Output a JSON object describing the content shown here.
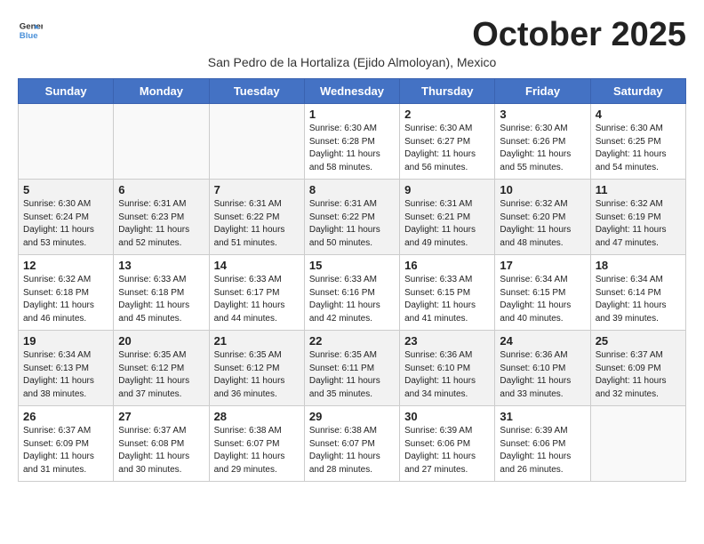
{
  "header": {
    "logo_line1": "General",
    "logo_line2": "Blue",
    "month_title": "October 2025",
    "subtitle": "San Pedro de la Hortaliza (Ejido Almoloyan), Mexico"
  },
  "days_of_week": [
    "Sunday",
    "Monday",
    "Tuesday",
    "Wednesday",
    "Thursday",
    "Friday",
    "Saturday"
  ],
  "weeks": [
    [
      {
        "day": "",
        "info": ""
      },
      {
        "day": "",
        "info": ""
      },
      {
        "day": "",
        "info": ""
      },
      {
        "day": "1",
        "info": "Sunrise: 6:30 AM\nSunset: 6:28 PM\nDaylight: 11 hours\nand 58 minutes."
      },
      {
        "day": "2",
        "info": "Sunrise: 6:30 AM\nSunset: 6:27 PM\nDaylight: 11 hours\nand 56 minutes."
      },
      {
        "day": "3",
        "info": "Sunrise: 6:30 AM\nSunset: 6:26 PM\nDaylight: 11 hours\nand 55 minutes."
      },
      {
        "day": "4",
        "info": "Sunrise: 6:30 AM\nSunset: 6:25 PM\nDaylight: 11 hours\nand 54 minutes."
      }
    ],
    [
      {
        "day": "5",
        "info": "Sunrise: 6:30 AM\nSunset: 6:24 PM\nDaylight: 11 hours\nand 53 minutes."
      },
      {
        "day": "6",
        "info": "Sunrise: 6:31 AM\nSunset: 6:23 PM\nDaylight: 11 hours\nand 52 minutes."
      },
      {
        "day": "7",
        "info": "Sunrise: 6:31 AM\nSunset: 6:22 PM\nDaylight: 11 hours\nand 51 minutes."
      },
      {
        "day": "8",
        "info": "Sunrise: 6:31 AM\nSunset: 6:22 PM\nDaylight: 11 hours\nand 50 minutes."
      },
      {
        "day": "9",
        "info": "Sunrise: 6:31 AM\nSunset: 6:21 PM\nDaylight: 11 hours\nand 49 minutes."
      },
      {
        "day": "10",
        "info": "Sunrise: 6:32 AM\nSunset: 6:20 PM\nDaylight: 11 hours\nand 48 minutes."
      },
      {
        "day": "11",
        "info": "Sunrise: 6:32 AM\nSunset: 6:19 PM\nDaylight: 11 hours\nand 47 minutes."
      }
    ],
    [
      {
        "day": "12",
        "info": "Sunrise: 6:32 AM\nSunset: 6:18 PM\nDaylight: 11 hours\nand 46 minutes."
      },
      {
        "day": "13",
        "info": "Sunrise: 6:33 AM\nSunset: 6:18 PM\nDaylight: 11 hours\nand 45 minutes."
      },
      {
        "day": "14",
        "info": "Sunrise: 6:33 AM\nSunset: 6:17 PM\nDaylight: 11 hours\nand 44 minutes."
      },
      {
        "day": "15",
        "info": "Sunrise: 6:33 AM\nSunset: 6:16 PM\nDaylight: 11 hours\nand 42 minutes."
      },
      {
        "day": "16",
        "info": "Sunrise: 6:33 AM\nSunset: 6:15 PM\nDaylight: 11 hours\nand 41 minutes."
      },
      {
        "day": "17",
        "info": "Sunrise: 6:34 AM\nSunset: 6:15 PM\nDaylight: 11 hours\nand 40 minutes."
      },
      {
        "day": "18",
        "info": "Sunrise: 6:34 AM\nSunset: 6:14 PM\nDaylight: 11 hours\nand 39 minutes."
      }
    ],
    [
      {
        "day": "19",
        "info": "Sunrise: 6:34 AM\nSunset: 6:13 PM\nDaylight: 11 hours\nand 38 minutes."
      },
      {
        "day": "20",
        "info": "Sunrise: 6:35 AM\nSunset: 6:12 PM\nDaylight: 11 hours\nand 37 minutes."
      },
      {
        "day": "21",
        "info": "Sunrise: 6:35 AM\nSunset: 6:12 PM\nDaylight: 11 hours\nand 36 minutes."
      },
      {
        "day": "22",
        "info": "Sunrise: 6:35 AM\nSunset: 6:11 PM\nDaylight: 11 hours\nand 35 minutes."
      },
      {
        "day": "23",
        "info": "Sunrise: 6:36 AM\nSunset: 6:10 PM\nDaylight: 11 hours\nand 34 minutes."
      },
      {
        "day": "24",
        "info": "Sunrise: 6:36 AM\nSunset: 6:10 PM\nDaylight: 11 hours\nand 33 minutes."
      },
      {
        "day": "25",
        "info": "Sunrise: 6:37 AM\nSunset: 6:09 PM\nDaylight: 11 hours\nand 32 minutes."
      }
    ],
    [
      {
        "day": "26",
        "info": "Sunrise: 6:37 AM\nSunset: 6:09 PM\nDaylight: 11 hours\nand 31 minutes."
      },
      {
        "day": "27",
        "info": "Sunrise: 6:37 AM\nSunset: 6:08 PM\nDaylight: 11 hours\nand 30 minutes."
      },
      {
        "day": "28",
        "info": "Sunrise: 6:38 AM\nSunset: 6:07 PM\nDaylight: 11 hours\nand 29 minutes."
      },
      {
        "day": "29",
        "info": "Sunrise: 6:38 AM\nSunset: 6:07 PM\nDaylight: 11 hours\nand 28 minutes."
      },
      {
        "day": "30",
        "info": "Sunrise: 6:39 AM\nSunset: 6:06 PM\nDaylight: 11 hours\nand 27 minutes."
      },
      {
        "day": "31",
        "info": "Sunrise: 6:39 AM\nSunset: 6:06 PM\nDaylight: 11 hours\nand 26 minutes."
      },
      {
        "day": "",
        "info": ""
      }
    ]
  ]
}
